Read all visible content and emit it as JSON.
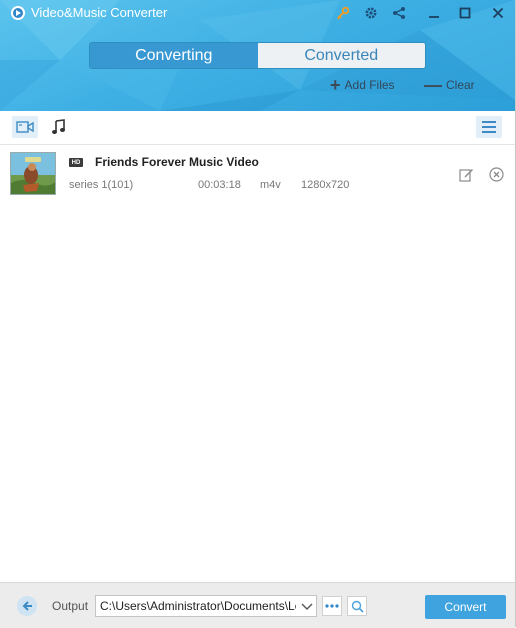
{
  "app": {
    "title": "Video&Music Converter",
    "accent_color": "#3ea3de",
    "header_color": "#3fb0e4"
  },
  "titlebar": {
    "icons": [
      "key-icon",
      "gear-icon",
      "share-icon",
      "minimize-icon",
      "maximize-icon",
      "close-icon"
    ]
  },
  "tabs": [
    {
      "label": "Converting",
      "active": true
    },
    {
      "label": "Converted",
      "active": false
    }
  ],
  "actions": {
    "add_files": "Add Files",
    "clear": "Clear"
  },
  "toolbar": {
    "icons": [
      "video-icon",
      "music-icon",
      "menu-icon"
    ]
  },
  "files": [
    {
      "badge": "HD",
      "title": "Friends Forever Music Video",
      "series": "series 1(101)",
      "duration": "00:03:18",
      "format": "m4v",
      "resolution": "1280x720"
    }
  ],
  "footer": {
    "output_label": "Output",
    "output_path": "C:\\Users\\Administrator\\Documents\\Leawo",
    "convert_label": "Convert"
  }
}
